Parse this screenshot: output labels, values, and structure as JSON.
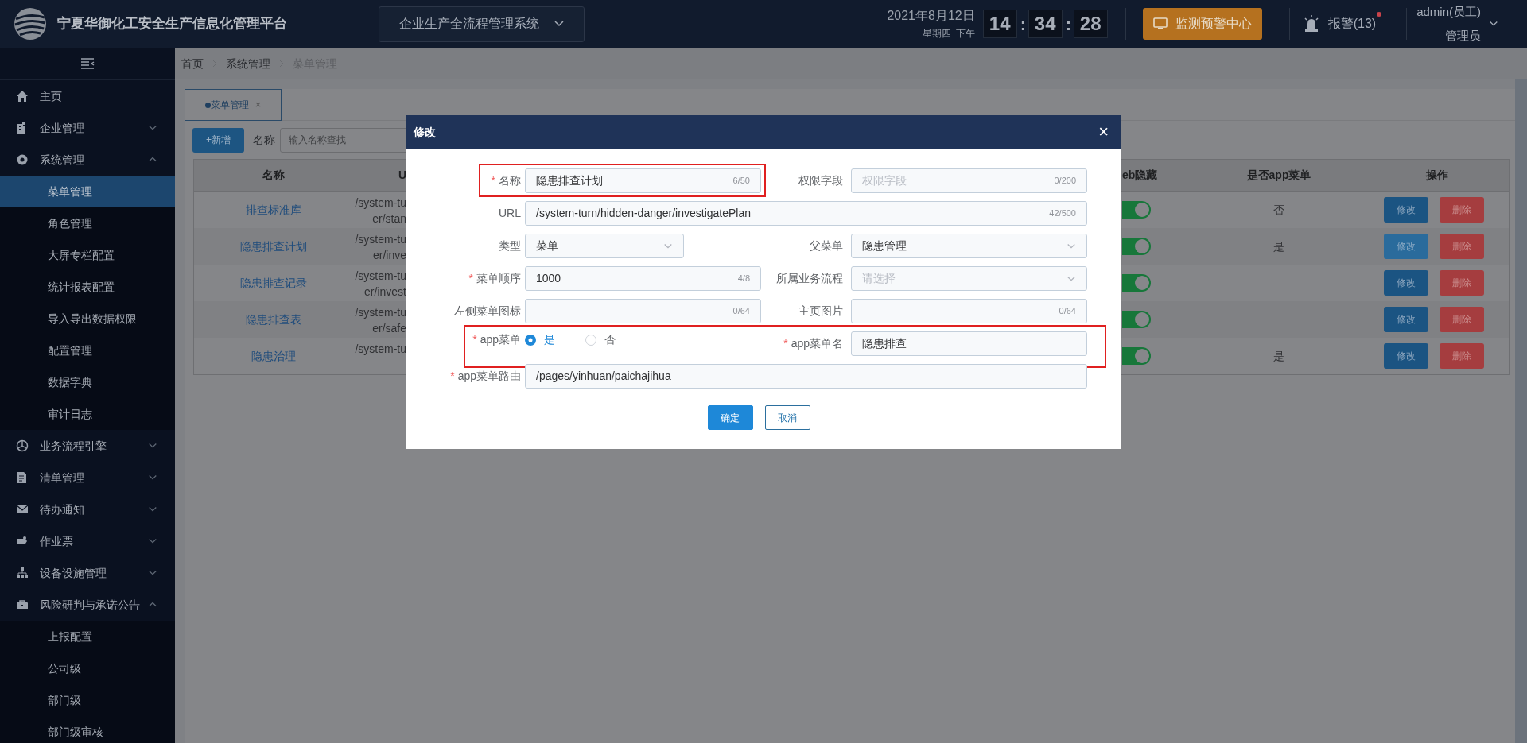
{
  "header": {
    "title": "宁夏华御化工安全生产信息化管理平台",
    "system_select": "企业生产全流程管理系统",
    "date": "2021年8月12日",
    "weekday": "星期四",
    "period": "下午",
    "clock": [
      {
        "kind": "digits",
        "text": "14"
      },
      {
        "kind": "sep",
        "text": ":"
      },
      {
        "kind": "digits",
        "text": "34"
      },
      {
        "kind": "sep",
        "text": ":"
      },
      {
        "kind": "digits",
        "text": "28"
      }
    ],
    "monitor_button": "监测预警中心",
    "alarm": {
      "label": "报警(13)",
      "unread": true
    },
    "user": {
      "name": "admin(员工)",
      "role": "管理员"
    }
  },
  "sidebar": {
    "items": [
      {
        "label": "主页",
        "kind": "link"
      },
      {
        "label": "企业管理",
        "kind": "group",
        "expanded": false
      },
      {
        "label": "系统管理",
        "kind": "group",
        "expanded": true,
        "children": [
          {
            "label": "菜单管理",
            "selected": true
          },
          {
            "label": "角色管理",
            "selected": false
          },
          {
            "label": "大屏专栏配置",
            "selected": false
          },
          {
            "label": "统计报表配置",
            "selected": false
          },
          {
            "label": "导入导出数据权限",
            "selected": false
          },
          {
            "label": "配置管理",
            "selected": false
          },
          {
            "label": "数据字典",
            "selected": false
          },
          {
            "label": "审计日志",
            "selected": false
          }
        ]
      },
      {
        "label": "业务流程引擎",
        "kind": "group",
        "expanded": false
      },
      {
        "label": "清单管理",
        "kind": "group",
        "expanded": false
      },
      {
        "label": "待办通知",
        "kind": "group",
        "expanded": false
      },
      {
        "label": "作业票",
        "kind": "group",
        "expanded": false
      },
      {
        "label": "设备设施管理",
        "kind": "group",
        "expanded": false
      },
      {
        "label": "风险研判与承诺公告",
        "kind": "group",
        "expanded": true,
        "children": [
          {
            "label": "上报配置",
            "selected": false
          },
          {
            "label": "公司级",
            "selected": false
          },
          {
            "label": "部门级",
            "selected": false
          },
          {
            "label": "部门级审核",
            "selected": false
          }
        ]
      }
    ]
  },
  "breadcrumb": [
    "首页",
    "系统管理",
    "菜单管理"
  ],
  "tabs": [
    {
      "label": "菜单管理",
      "selected": true,
      "close": "×"
    }
  ],
  "toolbar": {
    "add_button": "+新增",
    "search_label": "名称",
    "search_placeholder": "输入名称查找"
  },
  "table": {
    "columns": [
      "名称",
      "U",
      "eb隐藏",
      "是否app菜单",
      "操作"
    ],
    "rows": [
      {
        "name": "排查标准库",
        "url_lines": [
          "/system-tu",
          "er/stan"
        ],
        "web_hidden": true,
        "app_menu": "否",
        "edit": "修改",
        "delete": "删除",
        "edit_hovered": false
      },
      {
        "name": "隐患排查计划",
        "url_lines": [
          "/system-tu",
          "er/inve"
        ],
        "web_hidden": true,
        "app_menu": "是",
        "edit": "修改",
        "delete": "删除",
        "edit_hovered": true
      },
      {
        "name": "隐患排查记录",
        "url_lines": [
          "/system-tu",
          "er/invest"
        ],
        "web_hidden": true,
        "edit": "修改",
        "delete": "删除",
        "edit_hovered": false
      },
      {
        "name": "隐患排查表",
        "url_lines": [
          "/system-tu",
          "er/safe"
        ],
        "web_hidden": true,
        "edit": "修改",
        "delete": "删除",
        "edit_hovered": false
      },
      {
        "name": "隐患治理",
        "url_lines": [
          "/system-tu"
        ],
        "web_hidden": true,
        "app_menu": "是",
        "edit": "修改",
        "delete": "删除",
        "edit_hovered": false
      }
    ]
  },
  "dialog": {
    "title": "修改",
    "close": "×",
    "rows": [
      {
        "fields": [
          {
            "label": "名称",
            "required_mark": "*",
            "kind": "text",
            "value": "隐患排查计划",
            "counter": "6/50",
            "highlighted": true
          },
          {
            "label": "权限字段",
            "kind": "text",
            "placeholder": "权限字段",
            "counter": "0/200"
          }
        ]
      },
      {
        "fields": [
          {
            "label": "URL",
            "kind": "text_wide",
            "value": "/system-turn/hidden-danger/investigatePlan",
            "counter": "42/500"
          }
        ]
      },
      {
        "fields": [
          {
            "label": "类型",
            "kind": "select",
            "value": "菜单"
          },
          {
            "label": "父菜单",
            "kind": "select",
            "value": "隐患管理"
          }
        ]
      },
      {
        "fields": [
          {
            "label": "菜单顺序",
            "required_mark": "*",
            "kind": "text",
            "value": "1000",
            "counter": "4/8"
          },
          {
            "label": "所属业务流程",
            "kind": "select",
            "placeholder": "请选择"
          }
        ]
      },
      {
        "fields": [
          {
            "label": "左侧菜单图标",
            "kind": "text",
            "counter": "0/64"
          },
          {
            "label": "主页图片",
            "kind": "text",
            "counter": "0/64"
          }
        ]
      },
      {
        "highlighted": true,
        "fields": [
          {
            "label": "app菜单",
            "required_mark": "*",
            "kind": "radio",
            "options": [
              {
                "label": "是",
                "selected": true
              },
              {
                "label": "否",
                "selected": false
              }
            ]
          },
          {
            "label": "app菜单名",
            "required_mark": "*",
            "kind": "text",
            "value": "隐患排查"
          }
        ]
      },
      {
        "fields": [
          {
            "label": "app菜单路由",
            "required_mark": "*",
            "kind": "text_wide",
            "value": "/pages/yinhuan/paichajihua"
          }
        ]
      }
    ],
    "buttons": [
      {
        "label": "确定",
        "kind": "primary"
      },
      {
        "label": "取消",
        "kind": "secondary"
      }
    ]
  }
}
